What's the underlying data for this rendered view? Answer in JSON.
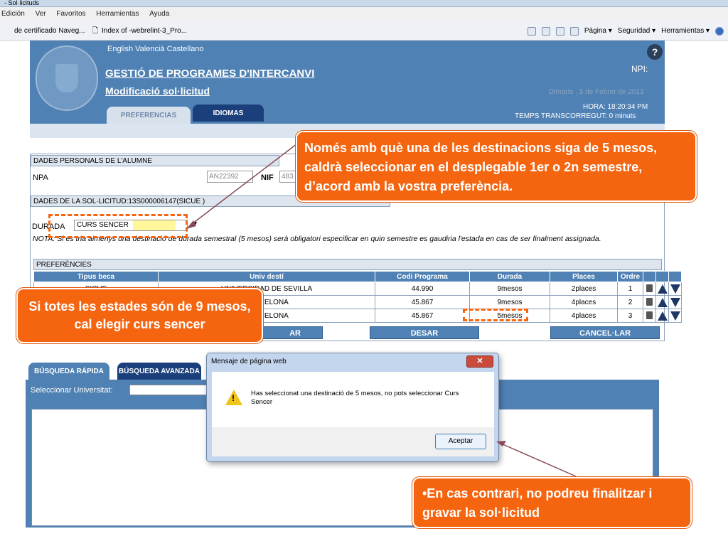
{
  "browser": {
    "tab_title": "- Sol·licituds",
    "menu": [
      "Edición",
      "Ver",
      "Favoritos",
      "Herramientas",
      "Ayuda"
    ],
    "favorites": [
      "de certificado Naveg...",
      "Index of -webrelint-3_Pro..."
    ],
    "commands": [
      "Página ▾",
      "Seguridad ▾",
      "Herramientas ▾"
    ]
  },
  "header": {
    "languages": "English  Valencià  Castellano",
    "title": "GESTIÓ DE PROGRAMES D'INTERCANVI",
    "subtitle": "Modificació sol·licitud",
    "help": "?",
    "npi": "NPI:",
    "date": "Dimarts , 5 de Febrer de 2013",
    "hora": "HORA:  18:20:34 PM",
    "temps": "TEMPS TRANSCORREGUT: 0 minuts",
    "tabs": [
      "PREFERENCIAS",
      "IDIOMAS"
    ]
  },
  "form": {
    "personal_section": "DADES PERSONALS DE L'ALUMNE",
    "npa_label": "NPA",
    "npa_value": "AN22392",
    "nif_label": "NIF",
    "nif_value": "483",
    "request_section": "DADES DE LA SOL·LICITUD:13S000006147(SICUE )",
    "duration_label": "DURADA",
    "duration_value": "CURS SENCER",
    "nota": "NOTA: Si es tria almenys una destinació de durada semestral (5 mesos) serà obligatori especificar en quin semestre es gaudiria l'estada en cas de ser finalment assignada.",
    "preferences_section": "PREFERÈNCIES",
    "columns": [
      "Tipus beca",
      "Univ destí",
      "Codi Programa",
      "Durada",
      "Places",
      "Ordre"
    ],
    "rows": [
      {
        "beca": "SICUE",
        "univ": "UNIVERSIDAD DE SEVILLA",
        "codi": "44.990",
        "durada": "9mesos",
        "places": "2places",
        "ordre": "1"
      },
      {
        "beca": "",
        "univ": "BARCELONA",
        "codi": "45.867",
        "durada": "9mesos",
        "places": "4places",
        "ordre": "2"
      },
      {
        "beca": "",
        "univ": "BARCELONA",
        "codi": "45.867",
        "durada": "5mesos",
        "places": "4places",
        "ordre": "3"
      }
    ],
    "buttons": {
      "first": "AR",
      "desar": "DESAR",
      "cancel": "CANCEL·LAR"
    }
  },
  "search": {
    "tabs": [
      "BÚSQUEDA RÁPIDA",
      "BÚSQUEDA AVANZADA"
    ],
    "select_label": "Seleccionar Universitat:"
  },
  "dialog": {
    "title": "Mensaje de página web",
    "close": "✕",
    "message": "Has seleccionat una destinació de 5 mesos, no pots seleccionar Curs Sencer",
    "ok": "Aceptar"
  },
  "callouts": {
    "top": "Només amb què una de les destinacions siga de 5 mesos, caldrà seleccionar en el desplegable 1er o 2n semestre, d’acord amb la vostra preferència.",
    "left": "Si totes les estades són de 9 mesos, cal elegir curs sencer",
    "bottom": "•En cas contrari, no podreu finalitzar i gravar la sol·licitud"
  },
  "colors": {
    "header": "#4f81b4",
    "callout": "#f5650f",
    "dark_tab": "#1a3f7a"
  }
}
